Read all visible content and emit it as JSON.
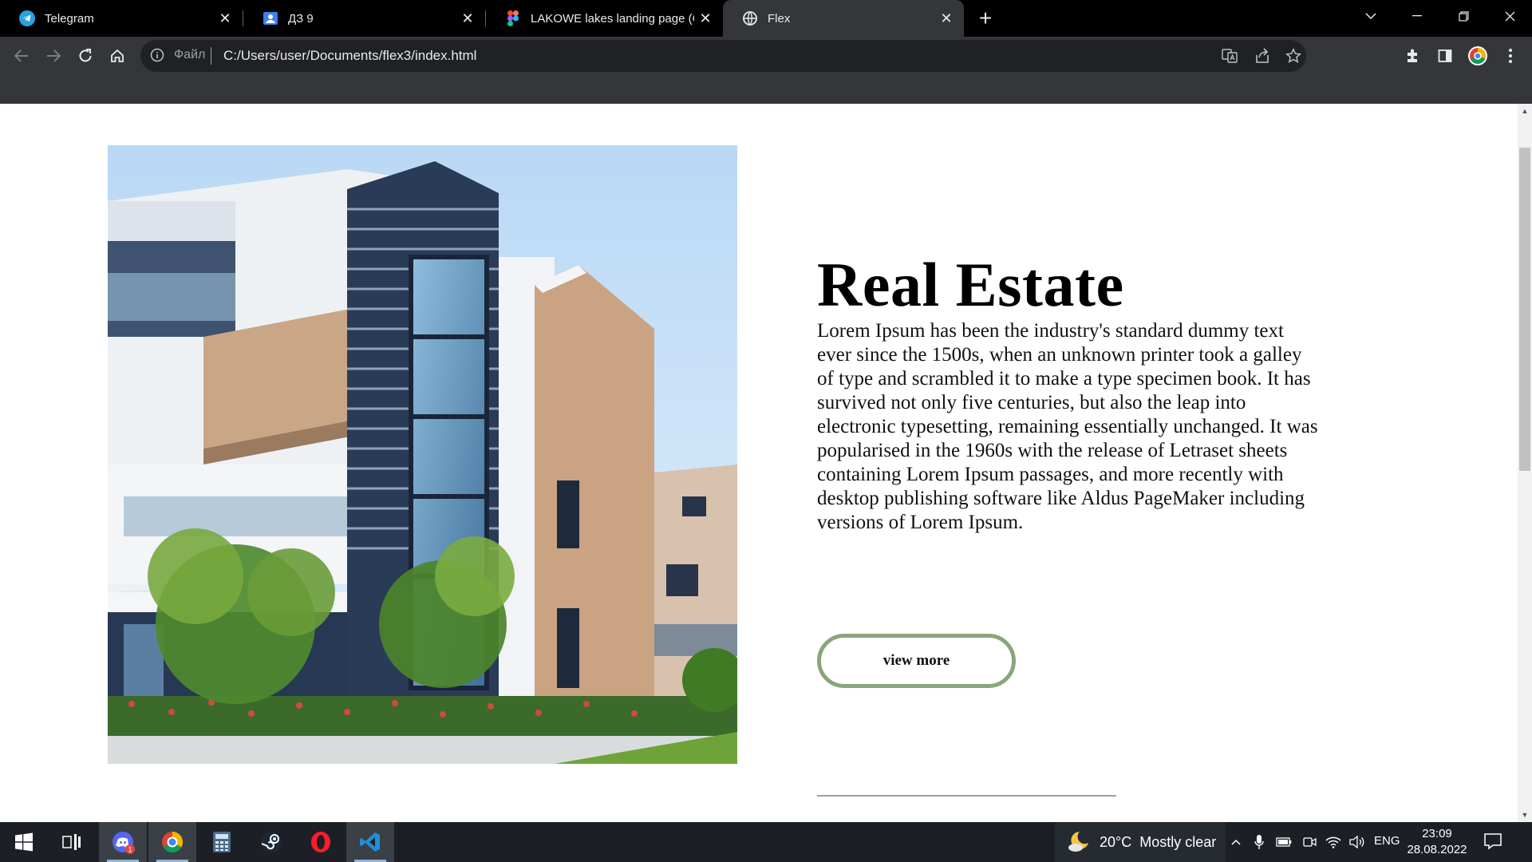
{
  "browser": {
    "tabs": [
      {
        "title": "Telegram",
        "icon": "telegram-icon",
        "active": false
      },
      {
        "title": "ДЗ 9",
        "icon": "classroom-icon",
        "active": false
      },
      {
        "title": "LAKOWE lakes landing page (Cor",
        "icon": "figma-icon",
        "active": false
      },
      {
        "title": "Flex",
        "icon": "globe-icon",
        "active": true
      }
    ],
    "new_tab_label": "+",
    "address_bar": {
      "scheme_label": "Файл",
      "url": "C:/Users/user/Documents/flex3/index.html"
    }
  },
  "page": {
    "headline": "Real Estate",
    "body": "Lorem Ipsum has been the industry's standard dummy text ever since the 1500s, when an unknown printer took a galley of type and scrambled it to make a type specimen book. It has survived not only five centuries, but also the leap into electronic typesetting, remaining essentially unchanged. It was popularised in the 1960s with the release of Letraset sheets containing Lorem Ipsum passages, and more recently with desktop publishing software like Aldus PageMaker including versions of Lorem Ipsum.",
    "cta_label": "view more",
    "accent_color": "#8aa57a"
  },
  "taskbar": {
    "weather": {
      "temp": "20°C",
      "condition": "Mostly clear"
    },
    "language": "ENG",
    "time": "23:09",
    "date": "28.08.2022",
    "discord_badge": "1"
  },
  "colors": {
    "tabstrip_bg": "#000000",
    "toolbar_bg": "#35363a",
    "omnibox_bg": "#202124",
    "taskbar_bg": "#1c2026"
  }
}
